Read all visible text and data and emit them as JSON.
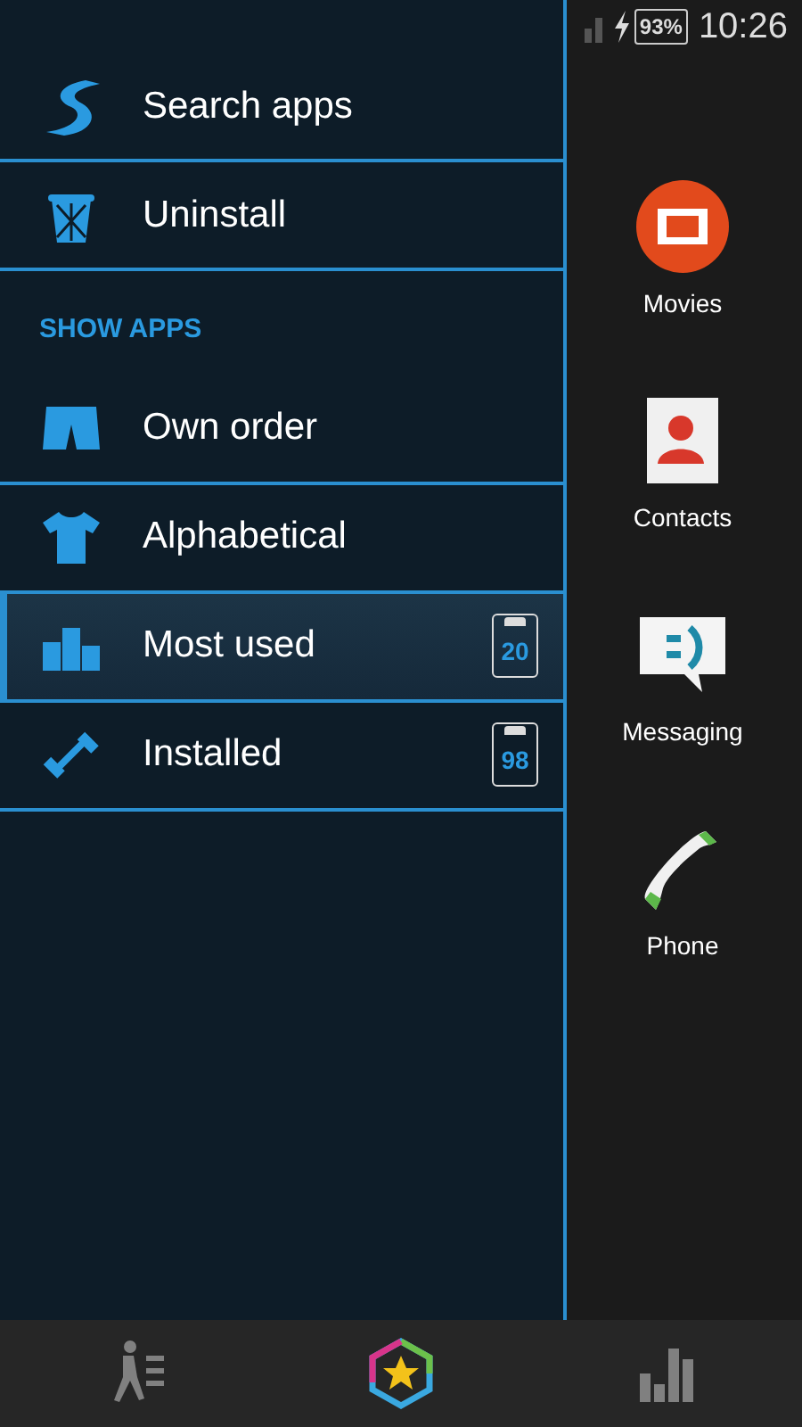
{
  "status_bar": {
    "battery": "93%",
    "charging": true,
    "time": "10:26"
  },
  "menu": {
    "actions": [
      {
        "kind": "search",
        "label": "Search apps"
      },
      {
        "kind": "uninstall",
        "label": "Uninstall"
      }
    ],
    "section_header": "SHOW APPS",
    "sort_options": [
      {
        "kind": "own-order",
        "label": "Own order",
        "selected": false
      },
      {
        "kind": "alphabetical",
        "label": "Alphabetical",
        "selected": false
      },
      {
        "kind": "most-used",
        "label": "Most used",
        "selected": true,
        "count": "20"
      },
      {
        "kind": "installed",
        "label": "Installed",
        "selected": false,
        "count": "98"
      }
    ]
  },
  "dock": [
    {
      "kind": "movies",
      "label": "Movies"
    },
    {
      "kind": "contacts",
      "label": "Contacts"
    },
    {
      "kind": "messaging",
      "label": "Messaging"
    },
    {
      "kind": "phone",
      "label": "Phone"
    }
  ],
  "bottom_bar": [
    {
      "kind": "runner",
      "selected": false
    },
    {
      "kind": "star",
      "selected": true
    },
    {
      "kind": "bars",
      "selected": false
    }
  ]
}
